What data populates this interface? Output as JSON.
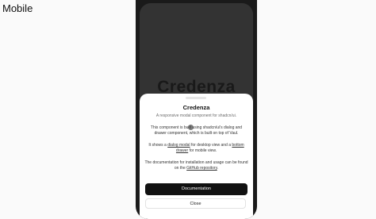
{
  "page": {
    "label": "Mobile"
  },
  "background": {
    "heading": "Credenza"
  },
  "drawer": {
    "title": "Credenza",
    "subtitle": "A responsive modal component for shadcn/ui.",
    "paragraph1": "This component is built using shadcn/ui's dialog and drawer component, which is built on top of Vaul.",
    "paragraph2": {
      "prefix": "It shows a ",
      "link1": "dialog modal",
      "middle": " for desktop view and a ",
      "link2": "bottom drawer",
      "suffix": " for mobile view."
    },
    "paragraph3": {
      "prefix": "The documentation for installation and usage can be found on the ",
      "link": "GitHub repository",
      "suffix": "."
    },
    "primary_button": "Documentation",
    "secondary_button": "Close"
  },
  "colors": {
    "page_background": "#fafafa",
    "phone_frame": "#1a1a1a",
    "screen_background": "#3c3c3c",
    "primary_button": "#111111",
    "drawer_background": "#ffffff"
  }
}
